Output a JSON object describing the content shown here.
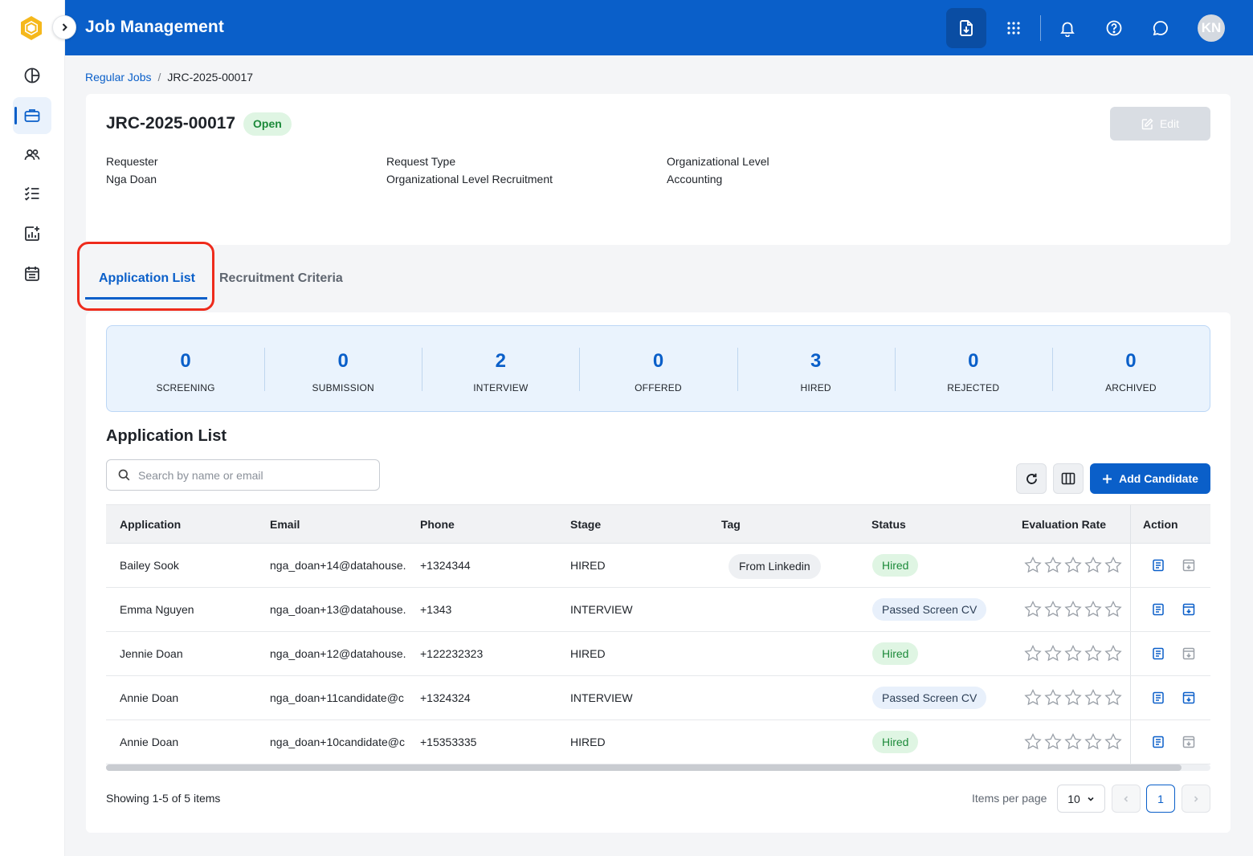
{
  "header": {
    "title": "Job Management",
    "avatar_initials": "KN"
  },
  "breadcrumb": {
    "parent": "Regular Jobs",
    "separator": "/",
    "current": "JRC-2025-00017"
  },
  "job": {
    "code": "JRC-2025-00017",
    "status": "Open",
    "edit_label": "Edit",
    "fields": [
      {
        "label": "Requester",
        "value": "Nga Doan"
      },
      {
        "label": "Request Type",
        "value": "Organizational Level Recruitment"
      },
      {
        "label": "Organizational Level",
        "value": "Accounting"
      }
    ]
  },
  "tabs": [
    {
      "label": "Application List",
      "active": true
    },
    {
      "label": "Recruitment Criteria",
      "active": false
    }
  ],
  "stats": [
    {
      "value": "0",
      "label": "SCREENING"
    },
    {
      "value": "0",
      "label": "SUBMISSION"
    },
    {
      "value": "2",
      "label": "INTERVIEW"
    },
    {
      "value": "0",
      "label": "OFFERED"
    },
    {
      "value": "3",
      "label": "HIRED"
    },
    {
      "value": "0",
      "label": "REJECTED"
    },
    {
      "value": "0",
      "label": "ARCHIVED"
    }
  ],
  "list": {
    "title": "Application List",
    "search_placeholder": "Search by name or email",
    "add_label": "Add Candidate"
  },
  "table": {
    "columns": [
      "Application",
      "Email",
      "Phone",
      "Stage",
      "Tag",
      "Status",
      "Evaluation Rate",
      "Action"
    ],
    "rows": [
      {
        "name": "Bailey Sook",
        "email": "nga_doan+14@datahouse.",
        "phone": "+1324344",
        "stage": "HIRED",
        "tag": "From Linkedin",
        "status": "Hired",
        "status_kind": "hired",
        "rating": 0
      },
      {
        "name": "Emma Nguyen",
        "email": "nga_doan+13@datahouse.",
        "phone": "+1343",
        "stage": "INTERVIEW",
        "tag": "",
        "status": "Passed Screen CV",
        "status_kind": "screen",
        "rating": 0
      },
      {
        "name": "Jennie Doan",
        "email": "nga_doan+12@datahouse.",
        "phone": "+122232323",
        "stage": "HIRED",
        "tag": "",
        "status": "Hired",
        "status_kind": "hired",
        "rating": 0
      },
      {
        "name": "Annie Doan",
        "email": "nga_doan+11candidate@c",
        "phone": "+1324324",
        "stage": "INTERVIEW",
        "tag": "",
        "status": "Passed Screen CV",
        "status_kind": "screen",
        "rating": 0
      },
      {
        "name": "Annie Doan",
        "email": "nga_doan+10candidate@c",
        "phone": "+15353335",
        "stage": "HIRED",
        "tag": "",
        "status": "Hired",
        "status_kind": "hired",
        "rating": 0
      }
    ]
  },
  "pagination": {
    "showing": "Showing 1-5 of 5 items",
    "items_per_page_label": "Items per page",
    "items_per_page": "10",
    "current_page": "1"
  },
  "colors": {
    "primary": "#0a5fc9",
    "hired_bg": "#dff5e3",
    "hired_text": "#1c8a3a",
    "highlight": "#ee2b1c"
  }
}
